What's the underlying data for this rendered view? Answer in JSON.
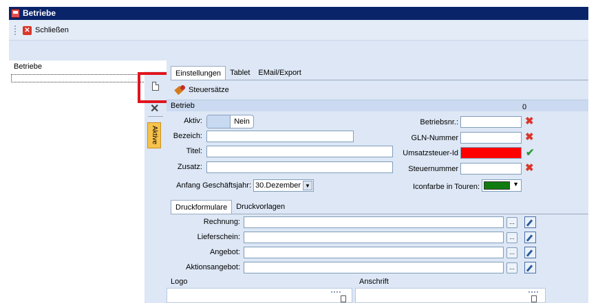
{
  "window": {
    "title": "Betriebe"
  },
  "toolbar": {
    "close_label": "Schließen"
  },
  "left": {
    "label": "Betriebe"
  },
  "side": {
    "aktive_tab": "Aktive"
  },
  "tabs": [
    "Einstellungen",
    "Tablet",
    "EMail/Export"
  ],
  "steuer_label": "Steuersätze",
  "group": {
    "title": "Betrieb",
    "count": "0"
  },
  "form": {
    "aktiv_label": "Aktiv:",
    "aktiv_value": "Nein",
    "bezeich_label": "Bezeich:",
    "titel_label": "Titel:",
    "zusatz_label": "Zusatz:",
    "anfang_label": "Anfang Geschäftsjahr:",
    "anfang_value": "30.Dezember",
    "betriebsnr_label": "Betriebsnr.:",
    "gln_label": "GLN-Nummer",
    "ust_label": "Umsatzsteuer-Id",
    "steuernr_label": "Steuernummer",
    "iconfarbe_label": "Iconfarbe in Touren:",
    "iconfarbe_color": "#107c10",
    "ust_bg_color": "#ff0000"
  },
  "druck_tabs": [
    "Druckformulare",
    "Druckvorlagen"
  ],
  "druck_rows": [
    {
      "label": "Rechnung:"
    },
    {
      "label": "Lieferschein:"
    },
    {
      "label": "Angebot:"
    },
    {
      "label": "Aktionsangebot:"
    }
  ],
  "dots_label": "...",
  "bottom": {
    "logo": "Logo",
    "anschrift": "Anschrift"
  }
}
